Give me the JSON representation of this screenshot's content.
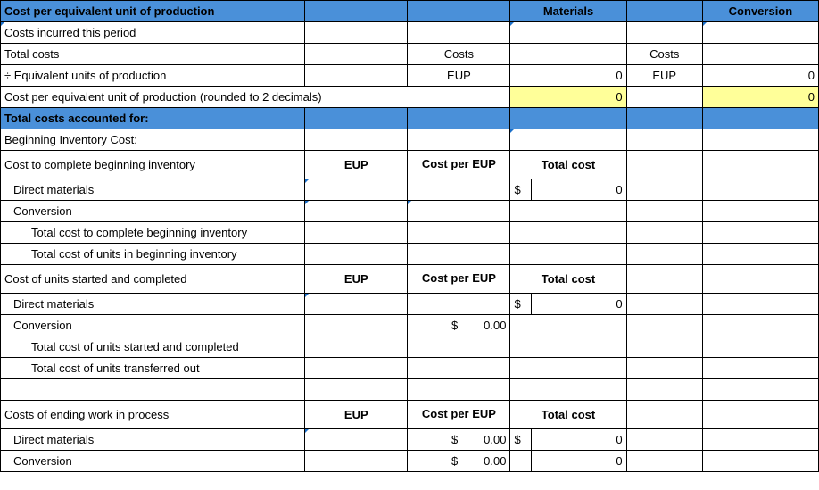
{
  "headers": {
    "cost_per_eup": "Cost per equivalent unit of production",
    "materials": "Materials",
    "conversion": "Conversion",
    "total_costs_accounted": "Total costs accounted for:"
  },
  "rows": {
    "costs_incurred": "Costs incurred this period",
    "total_costs": "Total costs",
    "costs_lbl": "Costs",
    "div_eup": "÷ Equivalent units of production",
    "eup_lbl": "EUP",
    "cost_per_eup_rounded": "Cost per equivalent unit of production (rounded to 2 decimals)",
    "beg_inv_cost": "Beginning Inventory Cost:",
    "cost_complete_beg": "Cost to complete beginning inventory",
    "col_eup": "EUP",
    "col_cost_per_eup": "Cost per EUP",
    "col_total_cost": "Total cost",
    "dm": "Direct materials",
    "conv": "Conversion",
    "total_cost_complete_beg": "Total cost to complete beginning inventory",
    "total_cost_units_beg": "Total cost of units in beginning inventory",
    "cost_units_started": "Cost of units started and completed",
    "total_cost_units_started": "Total cost of units started and completed",
    "total_cost_units_trans": "Total cost of units transferred out",
    "costs_ending_wip": "Costs of ending work in process"
  },
  "values": {
    "zero": "0",
    "dollar": "$",
    "zero_dec": "0.00"
  }
}
